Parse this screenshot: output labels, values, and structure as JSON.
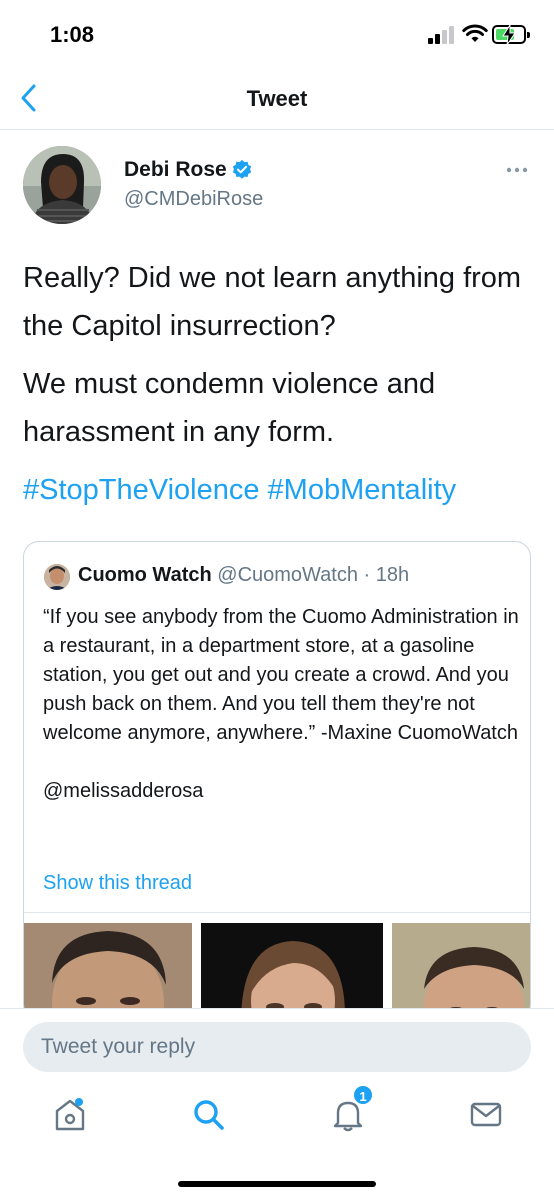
{
  "status_bar": {
    "time": "1:08"
  },
  "header": {
    "title": "Tweet"
  },
  "tweet": {
    "author_name": "Debi Rose",
    "author_handle": "@CMDebiRose",
    "paragraph_1": "Really?  Did we not learn anything from the Capitol insurrection?",
    "paragraph_2": "We must condemn violence  and harassment in any form.",
    "hashtags": [
      "#StopTheViolence",
      "#MobMentality"
    ]
  },
  "quoted_tweet": {
    "author_name": "Cuomo Watch",
    "author_handle": "@CuomoWatch",
    "time": "18h",
    "text": "“If you see anybody from the Cuomo Administration in a restaurant, in a department store, at a gasoline station, you get out and you create a crowd. And you push back on them. And you tell them they're not welcome anymore, anywhere.” -Maxine CuomoWatch\n\n@melissadderosa",
    "show_thread": "Show this thread"
  },
  "reply": {
    "placeholder": "Tweet your reply"
  },
  "tab_bar": {
    "notifications_badge": "1"
  },
  "colors": {
    "accent": "#1da1f2",
    "secondary_text": "#657786",
    "divider": "#e1e8ed"
  },
  "icons": [
    "back-chevron-icon",
    "verified-icon",
    "more-icon",
    "home-icon",
    "search-icon",
    "notifications-bell-icon",
    "messages-envelope-icon"
  ]
}
